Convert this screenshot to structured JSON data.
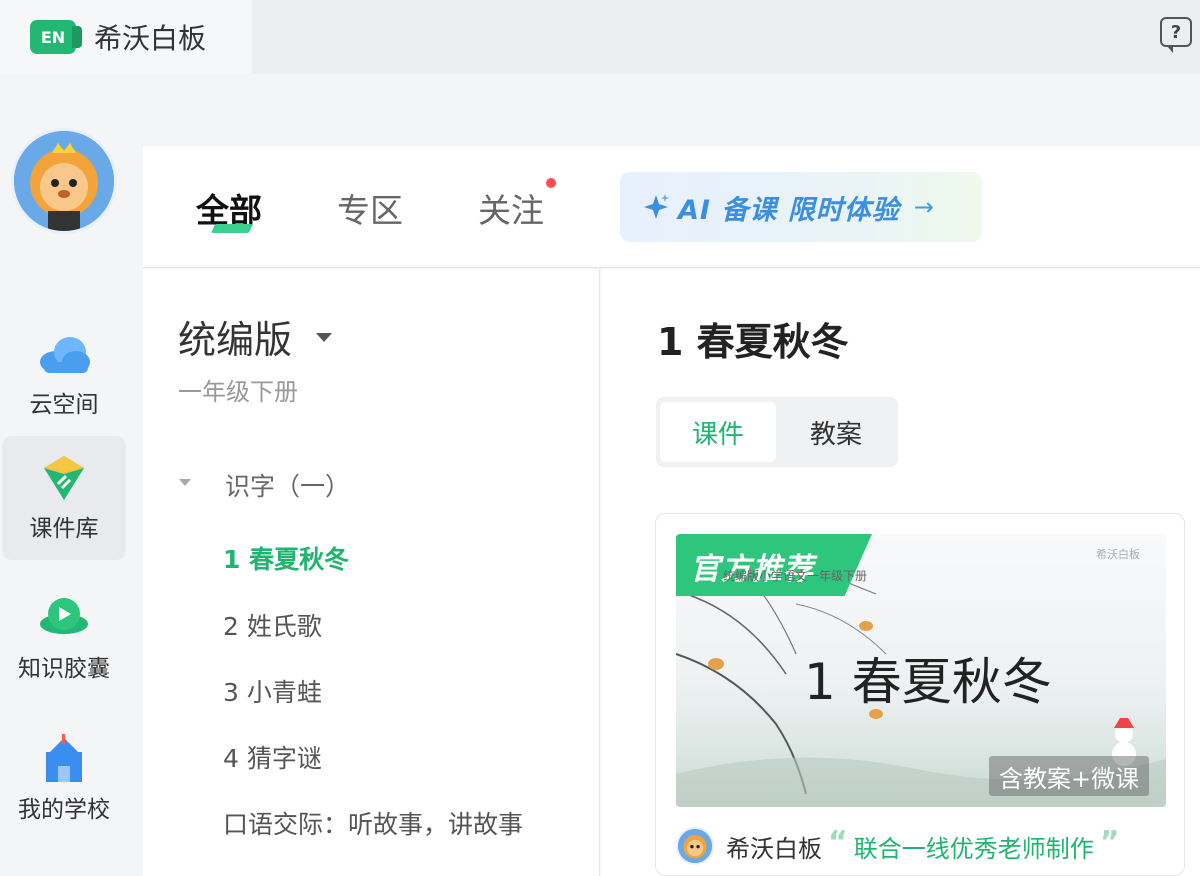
{
  "app": {
    "title": "希沃白板",
    "logo_text": "EN",
    "help_icon": "?"
  },
  "nav": {
    "avatar_icon": "lion-avatar-icon",
    "items": [
      {
        "label": "云空间",
        "icon": "cloud-icon",
        "active": false
      },
      {
        "label": "课件库",
        "icon": "courseware-library-icon",
        "active": true
      },
      {
        "label": "知识胶囊",
        "icon": "knowledge-capsule-icon",
        "active": false
      },
      {
        "label": "我的学校",
        "icon": "school-icon",
        "active": false
      }
    ]
  },
  "categories": {
    "tabs": [
      {
        "label": "全部",
        "active": true
      },
      {
        "label": "专区",
        "active": false
      },
      {
        "label": "关注",
        "active": false,
        "badge_dot": true
      }
    ],
    "ai_banner": {
      "text": "AI 备课 限时体验",
      "arrow": "→"
    }
  },
  "tree": {
    "edition": "统编版",
    "grade": "一年级下册",
    "unit": "识字（一）",
    "lessons": [
      {
        "label": "1 春夏秋冬",
        "active": true
      },
      {
        "label": "2 姓氏歌",
        "active": false
      },
      {
        "label": "3 小青蛙",
        "active": false
      },
      {
        "label": "4 猜字谜",
        "active": false
      },
      {
        "label": "口语交际：听故事，讲故事",
        "active": false
      }
    ]
  },
  "content": {
    "lesson_title": "1 春夏秋冬",
    "segments": [
      {
        "label": "课件",
        "active": true
      },
      {
        "label": "教案",
        "active": false
      }
    ],
    "card": {
      "ribbon": "官方推荐",
      "thumb_subtitle": "统编版小学语文一年级下册",
      "thumb_brand": "希沃白板",
      "thumb_title": "1  春夏秋冬",
      "badge": "含教案+微课",
      "author": "希沃白板",
      "slogan": "联合一线优秀老师制作",
      "quote_open": "“",
      "quote_close": "”"
    }
  },
  "colors": {
    "brand_green": "#1fb46f",
    "ai_blue": "#3a8fe0",
    "badge_red": "#ff4d4f"
  }
}
